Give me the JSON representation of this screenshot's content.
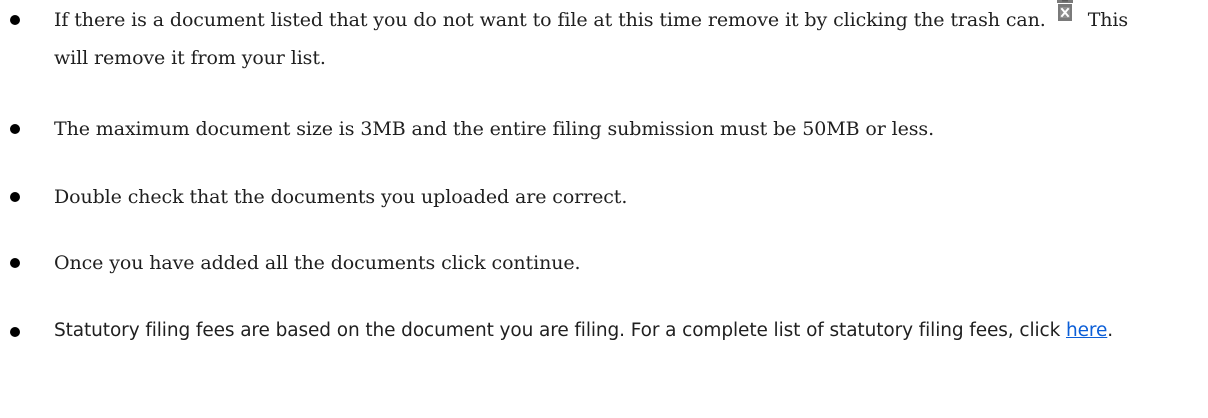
{
  "instructions": {
    "items": [
      {
        "text_before_icon": "If there is a document listed that you do not want to file at this time remove it by clicking the trash can.",
        "icon": "trash-icon",
        "text_after_icon": "This will remove it from your list."
      },
      {
        "text": "The maximum document size is 3MB and the entire filing submission must be 50MB or less."
      },
      {
        "text": "Double check that the documents you uploaded are correct."
      },
      {
        "text": "Once you have added all the documents click continue."
      },
      {
        "text_before_link": "Statutory filing fees are based on the document you are filing. For a complete list of statutory filing fees, click",
        "link_text": "here",
        "text_after_link": "."
      }
    ]
  },
  "colors": {
    "text": "#1f1f1f",
    "bullet": "#000000",
    "link": "#0b5ed7",
    "icon": "#7a7a7a"
  }
}
